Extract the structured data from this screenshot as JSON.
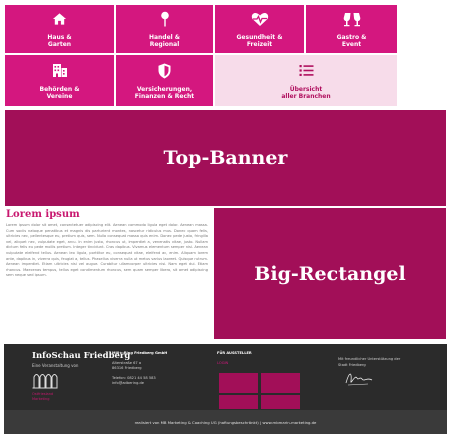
{
  "categories": [
    {
      "label": "Haus &\nGarten",
      "icon": "home-icon"
    },
    {
      "label": "Handel &\nRegional",
      "icon": "map-pin-icon"
    },
    {
      "label": "Gesundheit &\nFreizeit",
      "icon": "heartbeat-icon"
    },
    {
      "label": "Gastro &\nEvent",
      "icon": "glasses-cheers-icon"
    },
    {
      "label": "Behörden &\nVereine",
      "icon": "buildings-icon"
    },
    {
      "label": "Versicherungen,\nFinanzen & Recht",
      "icon": "shield-icon"
    },
    {
      "label": "Übersicht\naller Branchen",
      "icon": "list-icon"
    }
  ],
  "banners": {
    "top": "Top-Banner",
    "big": "Big-Rectangel"
  },
  "article": {
    "title": "Lorem ipsum",
    "body": "Lorem ipsum dolor sit amet, consectetuer adipiscing elit. Aenean commodo ligula eget dolor. Aenean massa. Cum sociis natoque penatibus et magnis dis parturient montes, nascetur ridiculus mus. Donec quam felis, ultricies nec, pellentesque eu, pretium quis, sem. Nulla consequat massa quis enim. Donec pede justo, fringilla vel, aliquet nec, vulputate eget, arcu. In enim justo, rhoncus ut, imperdiet a, venenatis vitae, justo. Nullam dictum felis eu pede mollis pretium. Integer tincidunt. Cras dapibus. Vivamus elementum semper nisi. Aenean vulputate eleifend tellus. Aenean leo ligula, porttitor eu, consequat vitae, eleifend ac, enim. Aliquam lorem ante, dapibus in, viverra quis, feugiat a, tellus. Phasellus viverra nulla ut metus varius laoreet. Quisque rutrum. Aenean imperdiet. Etiam ultricies nisi vel augue. Curabitur ullamcorper ultricies nisi. Nam eget dui. Etiam rhoncus. Maecenas tempus, tellus eget condimentum rhoncus, sem quam semper libero, sit amet adipiscing sem neque sed ipsum."
  },
  "footer": {
    "brand": "InfoSchau Friedberg",
    "tagline": "Eine Veranstaltung von",
    "logo_caption": "Ostfriesland\nMarketing",
    "company": {
      "name": "Mill+-Ring Friedberg GmbH",
      "street": "Alterstraße 67 a",
      "city": "86316 Friedberg",
      "phone": "Telefon: 0821 44 58 583",
      "email": "info@adbering.de"
    },
    "exhibitors": {
      "heading": "FÜR AUSSTELLER",
      "link": "LOGIN"
    },
    "support": "Mit freundlicher Unterstützung der\nStadt Friedberg"
  },
  "subfooter": "realisiert von MB Marketing & Coaching UG (haftungsbeschränkt) | www.mbmarin-marketing.de",
  "colors": {
    "tile": "#d4177f",
    "tile_light": "#f7dcea",
    "banner": "#a20f58",
    "footer": "#2b2b2b"
  }
}
